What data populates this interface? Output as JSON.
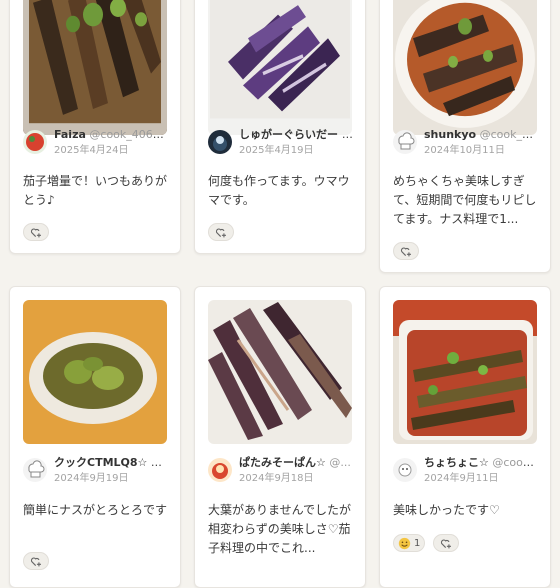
{
  "cards": [
    {
      "name": "Faiza",
      "handle": "@cook_40650...",
      "date": "2025年4月24日",
      "comment": "茄子増量で！いつもありがとう♪",
      "reactions": [
        {
          "emoji": "",
          "count": ""
        }
      ]
    },
    {
      "name": "しゅがーぐらいだー ...",
      "handle": "",
      "date": "2025年4月19日",
      "comment": "何度も作ってます。ウマウマです。",
      "reactions": [
        {
          "emoji": "",
          "count": ""
        }
      ]
    },
    {
      "name": "shunkyo",
      "handle": "@cook_40...",
      "date": "2024年10月11日",
      "comment": "めちゃくちゃ美味しすぎて、短期間で何度もリピしてます。ナス料理で1...",
      "reactions": [
        {
          "emoji": "",
          "count": ""
        }
      ]
    },
    {
      "name": "クックCTMLQ8☆",
      "handle": "@...",
      "date": "2024年9月19日",
      "comment": "簡単にナスがとろとろです",
      "reactions": [
        {
          "emoji": "",
          "count": ""
        }
      ]
    },
    {
      "name": "ぱたみそーぱん☆",
      "handle": "@...",
      "date": "2024年9月18日",
      "comment": "大葉がありませんでしたが相変わらずの美味しさ♡茄子料理の中でこれ...",
      "reactions": []
    },
    {
      "name": "ちょちょこ☆",
      "handle": "@cook...",
      "date": "2024年9月11日",
      "comment": "美味しかったです♡",
      "reactions": [
        {
          "emoji": "😊",
          "count": "1"
        },
        {
          "emoji": "",
          "count": ""
        }
      ]
    }
  ],
  "icons": {
    "reaction": "heart-plus-icon",
    "emoji": "smile-emoji-icon"
  },
  "colors": {
    "background": "#f5f3ee",
    "card": "#ffffff",
    "text": "#3b3b3b",
    "muted": "#a3a3a3"
  }
}
